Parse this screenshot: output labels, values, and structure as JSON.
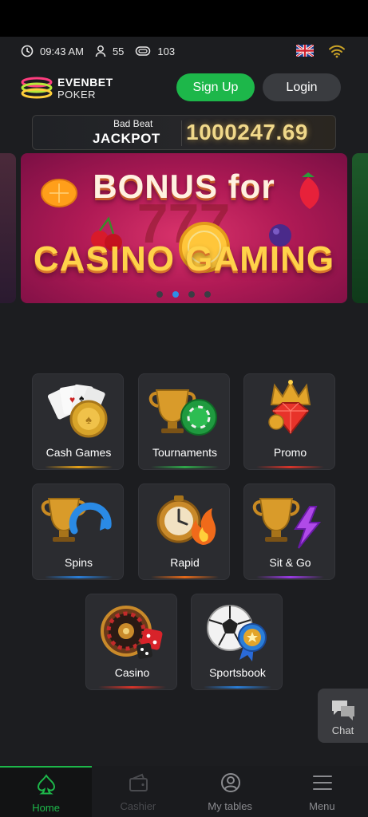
{
  "status": {
    "time": "09:43 AM",
    "players": "55",
    "tables": "103"
  },
  "header": {
    "logo_line1": "EVENBET",
    "logo_line2": "POKER",
    "signup_label": "Sign Up",
    "login_label": "Login"
  },
  "jackpot": {
    "label_top": "Bad Beat",
    "label_bottom": "JACKPOT",
    "value": "1000247.69"
  },
  "banner": {
    "line1": "BONUS for",
    "line2": "CASINO GAMING",
    "slide_count": 4,
    "active_slide": 2
  },
  "tiles": [
    {
      "label": "Cash Games",
      "icon": "cards-coin-icon",
      "glow": "#e5a21a"
    },
    {
      "label": "Tournaments",
      "icon": "trophy-chip-icon",
      "glow": "#2fa84a"
    },
    {
      "label": "Promo",
      "icon": "crown-gem-icon",
      "glow": "#d8342a"
    },
    {
      "label": "Spins",
      "icon": "trophy-spin-icon",
      "glow": "#2a7ed8"
    },
    {
      "label": "Rapid",
      "icon": "timer-fire-icon",
      "glow": "#e56a1a"
    },
    {
      "label": "Sit & Go",
      "icon": "trophy-bolt-icon",
      "glow": "#9a3ae5"
    },
    {
      "label": "Casino",
      "icon": "roulette-dice-icon",
      "glow": "#d8342a"
    },
    {
      "label": "Sportsbook",
      "icon": "ball-medal-icon",
      "glow": "#2a7ed8"
    }
  ],
  "chat": {
    "label": "Chat"
  },
  "nav": [
    {
      "label": "Home",
      "icon": "spade-icon"
    },
    {
      "label": "Cashier",
      "icon": "wallet-icon"
    },
    {
      "label": "My tables",
      "icon": "user-circle-icon"
    },
    {
      "label": "Menu",
      "icon": "hamburger-icon"
    }
  ],
  "colors": {
    "accent": "#1db74a",
    "background": "#1c1d20",
    "tile": "#2b2c30",
    "jackpot_value": "#f0d88a"
  }
}
